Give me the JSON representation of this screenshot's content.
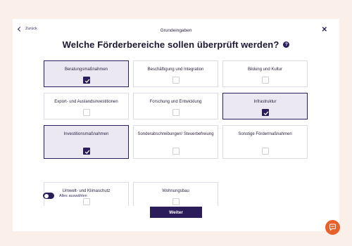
{
  "header": {
    "back_label": "Zurück",
    "subtitle": "Grundeingaben",
    "title": "Welche Förderbereiche sollen überprüft werden?",
    "help_glyph": "?",
    "close_glyph": "✕"
  },
  "options": [
    {
      "label": "Beratungsmaßnahmen",
      "selected": true
    },
    {
      "label": "Beschäftigung und Integration",
      "selected": false
    },
    {
      "label": "Bildung und Kultur",
      "selected": false
    },
    {
      "label": "Export- und Auslandsinvestitionen",
      "selected": false
    },
    {
      "label": "Forschung und Entwicklung",
      "selected": false
    },
    {
      "label": "Infrastruktur",
      "selected": true
    },
    {
      "label": "Investitionsmaßnahmen",
      "selected": true
    },
    {
      "label": "Sonderabschreibungen/ Steuerbefreiung",
      "selected": false
    },
    {
      "label": "Sonstige Fördermaßnahmen",
      "selected": false
    },
    {
      "label": "Umwelt- und Klimaschutz",
      "selected": false
    },
    {
      "label": "Wohnungsbau",
      "selected": false
    }
  ],
  "select_all": {
    "label": "Alles auswählen",
    "on": true
  },
  "submit_label": "Weiter",
  "colors": {
    "primary": "#2b1d5a",
    "selected_bg": "#ebe8f2",
    "page_bg": "#fbefe9",
    "chat_accent": "#e8612c"
  },
  "icons": {
    "back": "chevron-left-icon",
    "close": "close-icon",
    "help": "help-icon",
    "check": "checkmark-icon",
    "chat": "chat-icon"
  }
}
